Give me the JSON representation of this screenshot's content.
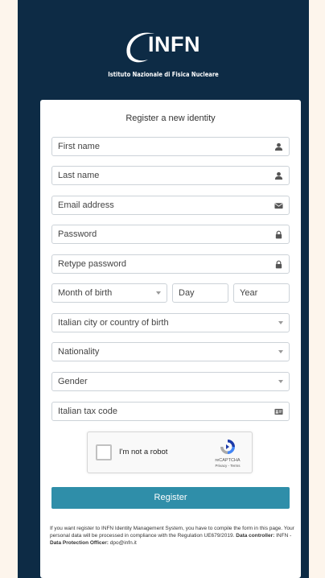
{
  "brand": {
    "logo_text": "INFN",
    "subtitle": "Istituto Nazionale di Fisica Nucleare"
  },
  "form": {
    "title": "Register a new identity",
    "fields": {
      "first_name": "First name",
      "last_name": "Last name",
      "email": "Email address",
      "password": "Password",
      "retype_password": "Retype password",
      "month_of_birth": "Month of birth",
      "day": "Day",
      "year": "Year",
      "birthplace": "Italian city or country of birth",
      "nationality": "Nationality",
      "gender": "Gender",
      "tax_code": "Italian tax code"
    },
    "captcha": {
      "label": "I'm not a robot",
      "brand": "reCAPTCHA",
      "links": "Privacy - Terms"
    },
    "register_label": "Register"
  },
  "footer": {
    "notice": "If you want register to INFN Identity Management System, you have to compile the form in this page. Your personal data will be processed in compliance with the Regulation UE679/2019.",
    "controller_label": "Data controller:",
    "controller_value": "INFN -",
    "dpo_label": "Data Protection Officer:",
    "dpo_value": "dpo@infn.it"
  },
  "colors": {
    "background": "#0d2b45",
    "accent": "#2f8ea9"
  },
  "icons": {
    "first_name": "user-icon",
    "last_name": "user-icon",
    "email": "envelope-icon",
    "password": "lock-icon",
    "retype_password": "lock-icon",
    "dropdowns": "chevron-down-icon",
    "tax_code": "id-card-icon"
  }
}
